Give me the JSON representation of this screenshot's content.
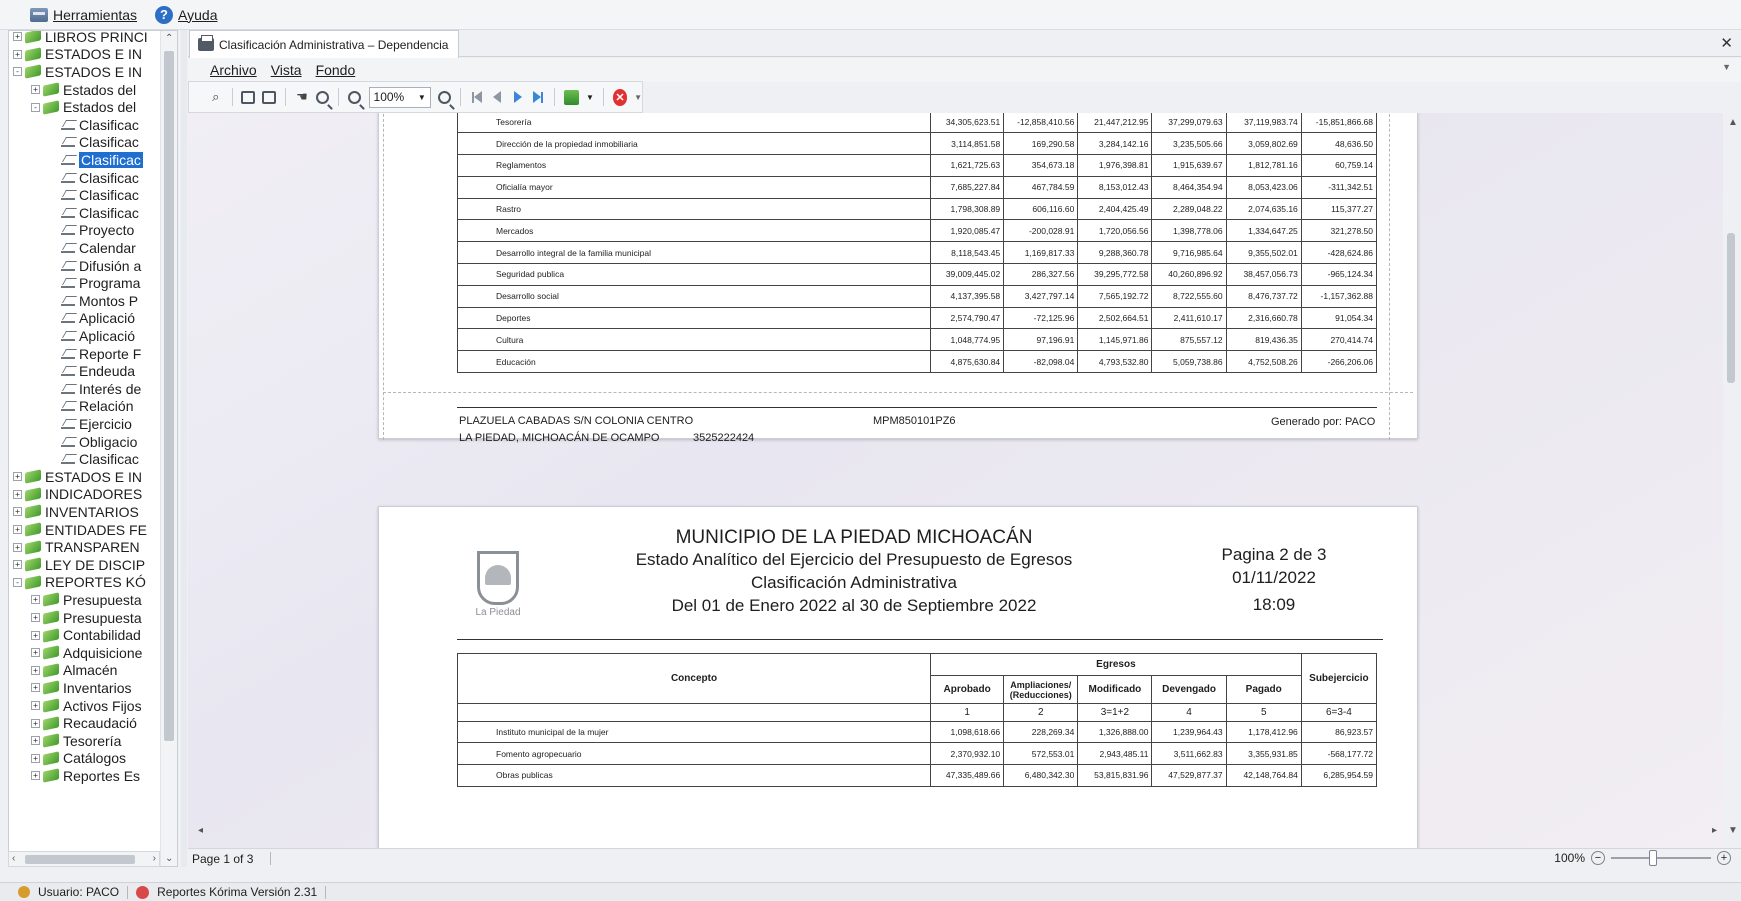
{
  "menu": {
    "tools": "Herramientas",
    "help": "Ayuda"
  },
  "tree": [
    {
      "label": "LIBROS PRINCI",
      "level": 0,
      "kind": "book",
      "exp": "+"
    },
    {
      "label": "ESTADOS E IN",
      "level": 0,
      "kind": "book",
      "exp": "+"
    },
    {
      "label": "ESTADOS E IN",
      "level": 0,
      "kind": "book",
      "exp": "-"
    },
    {
      "label": "Estados del",
      "level": 1,
      "kind": "book",
      "exp": "+"
    },
    {
      "label": "Estados del",
      "level": 1,
      "kind": "book",
      "exp": "-"
    },
    {
      "label": "Clasificac",
      "level": 2,
      "kind": "leaf"
    },
    {
      "label": "Clasificac",
      "level": 2,
      "kind": "leaf"
    },
    {
      "label": "Clasificac",
      "level": 2,
      "kind": "leaf",
      "selected": true
    },
    {
      "label": "Clasificac",
      "level": 2,
      "kind": "leaf"
    },
    {
      "label": "Clasificac",
      "level": 2,
      "kind": "leaf"
    },
    {
      "label": "Clasificac",
      "level": 2,
      "kind": "leaf"
    },
    {
      "label": "Proyecto",
      "level": 2,
      "kind": "leaf"
    },
    {
      "label": "Calendar",
      "level": 2,
      "kind": "leaf"
    },
    {
      "label": "Difusión a",
      "level": 2,
      "kind": "leaf"
    },
    {
      "label": "Programa",
      "level": 2,
      "kind": "leaf"
    },
    {
      "label": "Montos P",
      "level": 2,
      "kind": "leaf"
    },
    {
      "label": "Aplicació",
      "level": 2,
      "kind": "leaf"
    },
    {
      "label": "Aplicació",
      "level": 2,
      "kind": "leaf"
    },
    {
      "label": "Reporte F",
      "level": 2,
      "kind": "leaf"
    },
    {
      "label": "Endeuda",
      "level": 2,
      "kind": "leaf"
    },
    {
      "label": "Interés de",
      "level": 2,
      "kind": "leaf"
    },
    {
      "label": "Relación",
      "level": 2,
      "kind": "leaf"
    },
    {
      "label": "Ejercicio",
      "level": 2,
      "kind": "leaf"
    },
    {
      "label": "Obligacio",
      "level": 2,
      "kind": "leaf"
    },
    {
      "label": "Clasificac",
      "level": 2,
      "kind": "leaf"
    },
    {
      "label": "ESTADOS E IN",
      "level": 0,
      "kind": "book",
      "exp": "+"
    },
    {
      "label": "INDICADORES",
      "level": 0,
      "kind": "book",
      "exp": "+"
    },
    {
      "label": "INVENTARIOS",
      "level": 0,
      "kind": "book",
      "exp": "+"
    },
    {
      "label": "ENTIDADES FE",
      "level": 0,
      "kind": "book",
      "exp": "+"
    },
    {
      "label": "TRANSPAREN",
      "level": 0,
      "kind": "book",
      "exp": "+"
    },
    {
      "label": "LEY DE DISCIP",
      "level": 0,
      "kind": "book",
      "exp": "+"
    },
    {
      "label": "REPORTES KÓ",
      "level": 0,
      "kind": "book",
      "exp": "-"
    },
    {
      "label": "Presupuesta",
      "level": 1,
      "kind": "book",
      "exp": "+"
    },
    {
      "label": "Presupuesta",
      "level": 1,
      "kind": "book",
      "exp": "+"
    },
    {
      "label": "Contabilidad",
      "level": 1,
      "kind": "book",
      "exp": "+"
    },
    {
      "label": "Adquisicione",
      "level": 1,
      "kind": "book",
      "exp": "+"
    },
    {
      "label": "Almacén",
      "level": 1,
      "kind": "book",
      "exp": "+"
    },
    {
      "label": "Inventarios",
      "level": 1,
      "kind": "book",
      "exp": "+"
    },
    {
      "label": "Activos Fijos",
      "level": 1,
      "kind": "book",
      "exp": "+"
    },
    {
      "label": "Recaudació",
      "level": 1,
      "kind": "book",
      "exp": "+"
    },
    {
      "label": "Tesorería",
      "level": 1,
      "kind": "book",
      "exp": "+"
    },
    {
      "label": "Catálogos",
      "level": 1,
      "kind": "book",
      "exp": "+"
    },
    {
      "label": "Reportes Es",
      "level": 1,
      "kind": "book",
      "exp": "+"
    }
  ],
  "doc": {
    "tab_title": "Clasificación Administrativa – Dependencia",
    "submenu": {
      "file": "Archivo",
      "view": "Vista",
      "background": "Fondo"
    },
    "zoom_value": "100%"
  },
  "page1": {
    "rows": [
      {
        "concept": "Tesorería",
        "v": [
          "34,305,623.51",
          "-12,858,410.56",
          "21,447,212.95",
          "37,299,079.63",
          "37,119,983.74",
          "-15,851,866.68"
        ]
      },
      {
        "concept": "Dirección de la propiedad inmobiliaria",
        "v": [
          "3,114,851.58",
          "169,290.58",
          "3,284,142.16",
          "3,235,505.66",
          "3,059,802.69",
          "48,636.50"
        ]
      },
      {
        "concept": "Reglamentos",
        "v": [
          "1,621,725.63",
          "354,673.18",
          "1,976,398.81",
          "1,915,639.67",
          "1,812,781.16",
          "60,759.14"
        ]
      },
      {
        "concept": "Oficialía mayor",
        "v": [
          "7,685,227.84",
          "467,784.59",
          "8,153,012.43",
          "8,464,354.94",
          "8,053,423.06",
          "-311,342.51"
        ]
      },
      {
        "concept": "Rastro",
        "v": [
          "1,798,308.89",
          "606,116.60",
          "2,404,425.49",
          "2,289,048.22",
          "2,074,635.16",
          "115,377.27"
        ]
      },
      {
        "concept": "Mercados",
        "v": [
          "1,920,085.47",
          "-200,028.91",
          "1,720,056.56",
          "1,398,778.06",
          "1,334,647.25",
          "321,278.50"
        ]
      },
      {
        "concept": "Desarrollo integral de la familia municipal",
        "v": [
          "8,118,543.45",
          "1,169,817.33",
          "9,288,360.78",
          "9,716,985.64",
          "9,355,502.01",
          "-428,624.86"
        ]
      },
      {
        "concept": "Seguridad publica",
        "v": [
          "39,009,445.02",
          "286,327.56",
          "39,295,772.58",
          "40,260,896.92",
          "38,457,056.73",
          "-965,124.34"
        ]
      },
      {
        "concept": "Desarrollo social",
        "v": [
          "4,137,395.58",
          "3,427,797.14",
          "7,565,192.72",
          "8,722,555.60",
          "8,476,737.72",
          "-1,157,362.88"
        ]
      },
      {
        "concept": "Deportes",
        "v": [
          "2,574,790.47",
          "-72,125.96",
          "2,502,664.51",
          "2,411,610.17",
          "2,316,660.78",
          "91,054.34"
        ]
      },
      {
        "concept": "Cultura",
        "v": [
          "1,048,774.95",
          "97,196.91",
          "1,145,971.86",
          "875,557.12",
          "819,436.35",
          "270,414.74"
        ]
      },
      {
        "concept": "Educación",
        "v": [
          "4,875,630.84",
          "-82,098.04",
          "4,793,532.80",
          "5,059,738.86",
          "4,752,508.26",
          "-266,206.06"
        ]
      }
    ],
    "footer": {
      "address": "PLAZUELA CABADAS S/N COLONIA CENTRO",
      "rfc": "MPM850101PZ6",
      "generated": "Generado por: PACO",
      "city": "LA PIEDAD, MICHOACÁN DE OCAMPO",
      "phone": "3525222424"
    }
  },
  "page2": {
    "title1": "MUNICIPIO DE LA PIEDAD MICHOACÁN",
    "title2": "Estado Analítico del Ejercicio del Presupuesto de Egresos",
    "title3": "Clasificación Administrativa",
    "title4": "Del 01 de Enero 2022 al 30 de Septiembre 2022",
    "page_label": "Pagina 2 de 3",
    "date": "01/11/2022",
    "time": "18:09",
    "logo_text": "La Piedad",
    "headers": {
      "concept": "Concepto",
      "egresos": "Egresos",
      "approved": "Aprobado",
      "adjust": "Ampliaciones/ (Reducciones)",
      "modified": "Modificado",
      "accrued": "Devengado",
      "paid": "Pagado",
      "under": "Subejercicio",
      "n1": "1",
      "n2": "2",
      "n3": "3=1+2",
      "n4": "4",
      "n5": "5",
      "n6": "6=3-4"
    },
    "rows": [
      {
        "concept": "Instituto municipal de la mujer",
        "v": [
          "1,098,618.66",
          "228,269.34",
          "1,326,888.00",
          "1,239,964.43",
          "1,178,412.96",
          "86,923.57"
        ]
      },
      {
        "concept": "Fomento agropecuario",
        "v": [
          "2,370,932.10",
          "572,553.01",
          "2,943,485.11",
          "3,511,662.83",
          "3,355,931.85",
          "-568,177.72"
        ]
      },
      {
        "concept": "Obras publicas",
        "v": [
          "47,335,489.66",
          "6,480,342.30",
          "53,815,831.96",
          "47,529,877.37",
          "42,148,764.84",
          "6,285,954.59"
        ]
      }
    ]
  },
  "pagebar": {
    "page_status": "Page 1 of 3",
    "zoom": "100%"
  },
  "status": {
    "user": "Usuario: PACO",
    "app": "Reportes Kórima Versión 2.31"
  }
}
